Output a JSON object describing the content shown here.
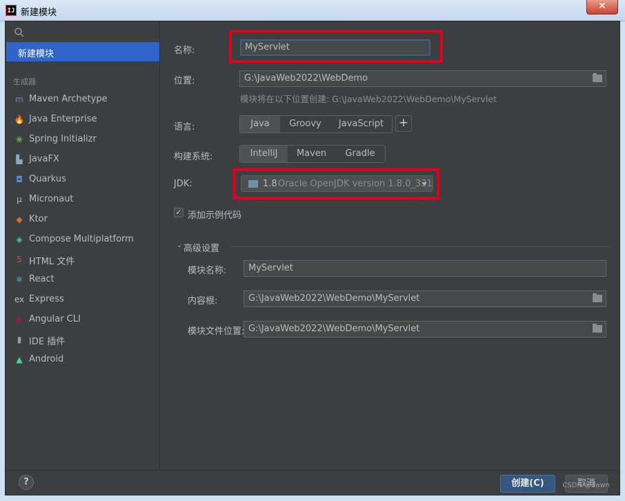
{
  "window": {
    "title": "新建模块",
    "app_icon_text": "IJ",
    "close_glyph": "✕"
  },
  "sidebar": {
    "selected": "新建模块",
    "group_label": "生成器",
    "items": [
      {
        "label": "Maven Archetype",
        "icon": "maven-icon",
        "glyph": "m",
        "color": "#6b86c9"
      },
      {
        "label": "Java Enterprise",
        "icon": "java-enterprise-icon",
        "glyph": "🔥",
        "color": "#f0a13a"
      },
      {
        "label": "Spring Initializr",
        "icon": "spring-icon",
        "glyph": "❀",
        "color": "#6db33f"
      },
      {
        "label": "JavaFX",
        "icon": "javafx-icon",
        "glyph": "▙",
        "color": "#8aa8c4"
      },
      {
        "label": "Quarkus",
        "icon": "quarkus-icon",
        "glyph": "◘",
        "color": "#4695eb"
      },
      {
        "label": "Micronaut",
        "icon": "micronaut-icon",
        "glyph": "μ",
        "color": "#bbbbbb"
      },
      {
        "label": "Ktor",
        "icon": "ktor-icon",
        "glyph": "◆",
        "color": "#e06a2d"
      },
      {
        "label": "Compose Multiplatform",
        "icon": "compose-icon",
        "glyph": "◈",
        "color": "#4fc3a1"
      },
      {
        "label": "HTML 文件",
        "icon": "html-icon",
        "glyph": "5",
        "color": "#e44d26"
      },
      {
        "label": "React",
        "icon": "react-icon",
        "glyph": "⚛",
        "color": "#61dafb"
      },
      {
        "label": "Express",
        "icon": "express-icon",
        "glyph": "ex",
        "color": "#bbbbbb"
      },
      {
        "label": "Angular CLI",
        "icon": "angular-icon",
        "glyph": "A",
        "color": "#dd0031"
      },
      {
        "label": "IDE 插件",
        "icon": "ide-plugin-icon",
        "glyph": "▮",
        "color": "#9a9a9a"
      },
      {
        "label": "Android",
        "icon": "android-icon",
        "glyph": "▲",
        "color": "#3ddc84"
      }
    ]
  },
  "form": {
    "name_label": "名称:",
    "name_value": "MyServlet",
    "location_label": "位置:",
    "location_value": "G:\\JavaWeb2022\\WebDemo",
    "location_hint": "模块将在以下位置创建: G:\\JavaWeb2022\\WebDemo\\MyServlet",
    "language_label": "语言:",
    "languages": [
      "Java",
      "Groovy",
      "JavaScript"
    ],
    "language_selected": "Java",
    "build_label": "构建系统:",
    "build_systems": [
      "IntelliJ",
      "Maven",
      "Gradle"
    ],
    "build_selected": "IntelliJ",
    "jdk_label": "JDK:",
    "jdk_version": "1.8",
    "jdk_desc": "Oracle OpenJDK version 1.8.0_331",
    "sample_code_label": "添加示例代码",
    "sample_code_checked": true
  },
  "advanced": {
    "header": "高级设置",
    "module_name_label": "模块名称:",
    "module_name_value": "MyServlet",
    "content_root_label": "内容根:",
    "content_root_value": "G:\\JavaWeb2022\\WebDemo\\MyServlet",
    "module_file_label": "模块文件位置:",
    "module_file_value": "G:\\JavaWeb2022\\WebDemo\\MyServlet"
  },
  "buttons": {
    "help": "?",
    "create": "创建(C)",
    "cancel": "取消"
  },
  "watermark": "CSDN @dawn",
  "colors": {
    "accent": "#2f65ca",
    "highlight_box": "#e2001a",
    "background": "#3c3f41"
  }
}
